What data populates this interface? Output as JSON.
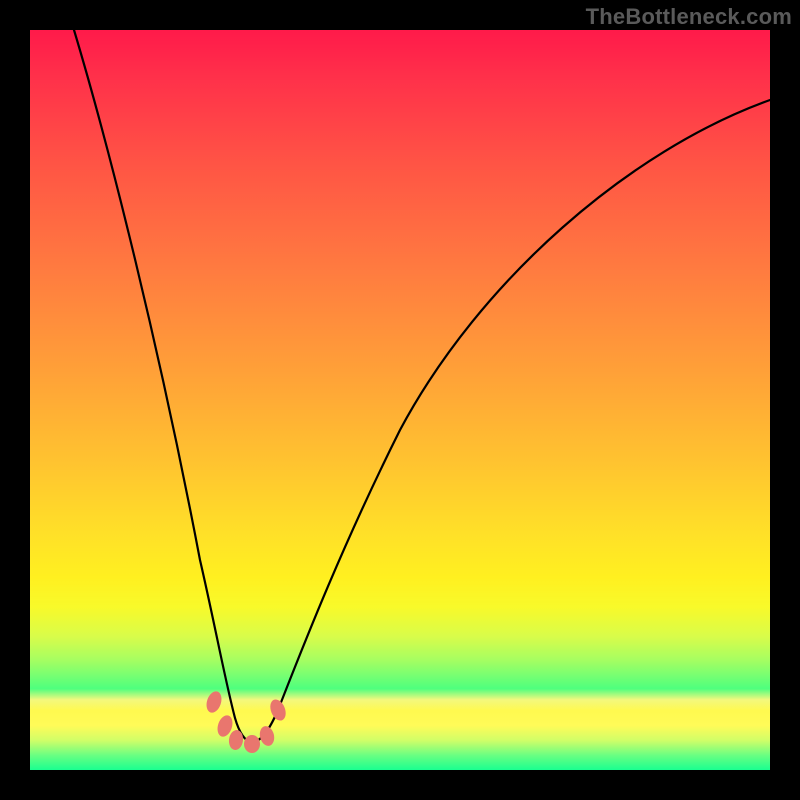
{
  "brand": "TheBottleneck.com",
  "chart_data": {
    "type": "line",
    "title": "",
    "xlabel": "",
    "ylabel": "",
    "xlim": [
      0,
      100
    ],
    "ylim": [
      0,
      100
    ],
    "x": [
      6,
      10,
      14,
      18,
      22,
      24,
      26,
      27,
      28,
      29,
      30,
      32,
      34,
      38,
      44,
      52,
      62,
      74,
      88,
      100
    ],
    "y": [
      100,
      82,
      64,
      46,
      28,
      18,
      10,
      6,
      4,
      3,
      3,
      4,
      6,
      12,
      22,
      36,
      52,
      66,
      78,
      86
    ],
    "markers_x": [
      24.5,
      26.0,
      27.5,
      29.5,
      31.5,
      33.0
    ],
    "markers_y": [
      9.0,
      5.5,
      3.5,
      3.0,
      4.5,
      8.5
    ],
    "gradient_note": "background gradient goes from red (top, high bottleneck) to green (bottom, low bottleneck)"
  }
}
